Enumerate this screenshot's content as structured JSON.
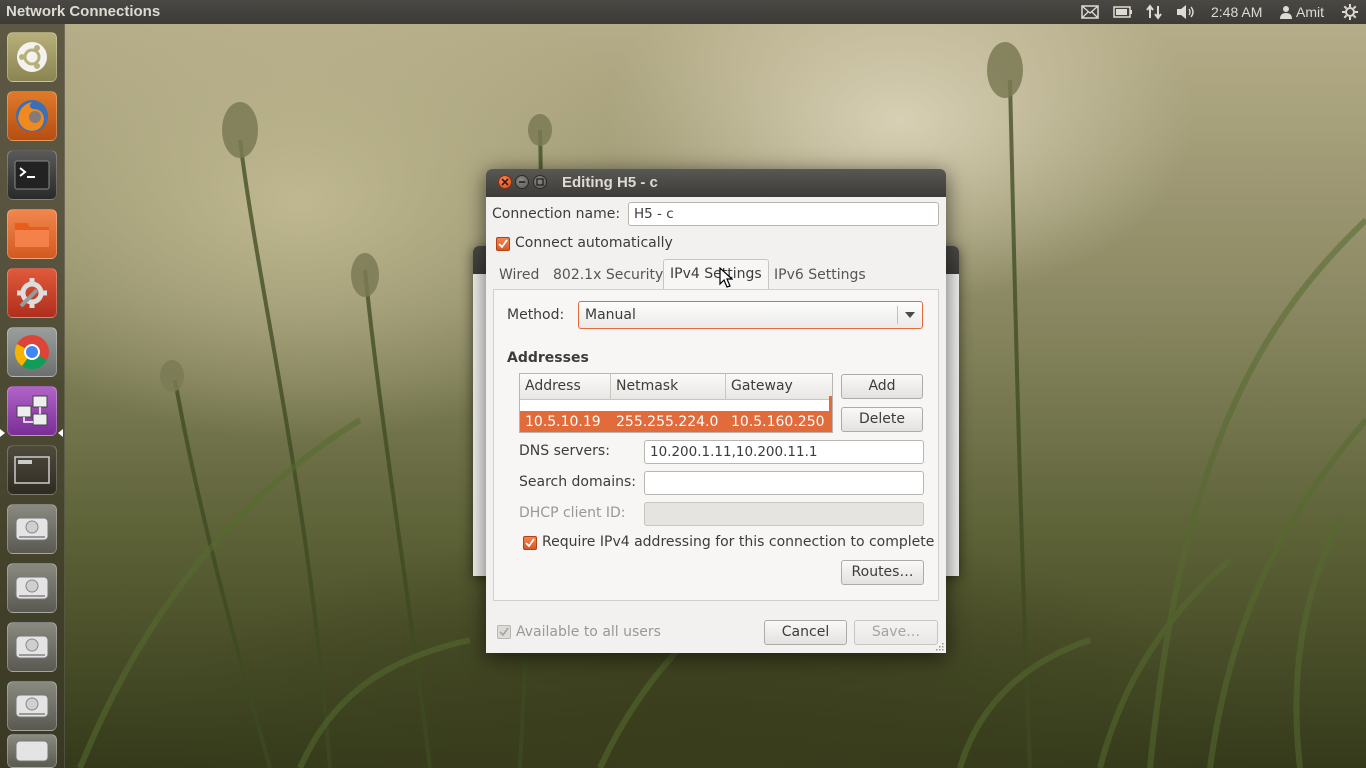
{
  "top_panel": {
    "app_title": "Network Connections",
    "clock": "2:48 AM",
    "user": "Amit",
    "tray_icons": [
      "mail-icon",
      "battery-icon",
      "network-transfer-icon",
      "volume-icon",
      "user-icon",
      "session-gear-icon"
    ]
  },
  "launcher": {
    "items": [
      "dash-home",
      "firefox",
      "terminal",
      "files",
      "system-settings",
      "chrome",
      "network-connections",
      "workspace-switcher",
      "drive",
      "drive",
      "drive",
      "drive",
      "drive"
    ]
  },
  "dialog": {
    "title": "Editing H5 - c",
    "connection_name_label": "Connection name:",
    "connection_name_value": "H5 - c",
    "connect_auto_label": "Connect automatically",
    "connect_auto_checked": true,
    "tabs": [
      {
        "label": "Wired",
        "active": false
      },
      {
        "label": "802.1x Security",
        "active": false
      },
      {
        "label": "IPv4 Settings",
        "active": true
      },
      {
        "label": "IPv6 Settings",
        "active": false
      }
    ],
    "method_label": "Method:",
    "method_value": "Manual",
    "addresses_heading": "Addresses",
    "address_columns": [
      "Address",
      "Netmask",
      "Gateway"
    ],
    "address_rows": [
      {
        "address": "10.5.10.19",
        "netmask": "255.255.224.0",
        "gateway": "10.5.160.250"
      }
    ],
    "add_button": "Add",
    "delete_button": "Delete",
    "dns_label": "DNS servers:",
    "dns_value": "10.200.1.11,10.200.11.1",
    "search_domains_label": "Search domains:",
    "search_domains_value": "",
    "dhcp_client_id_label": "DHCP client ID:",
    "dhcp_client_id_value": "",
    "require_ipv4_label": "Require IPv4 addressing for this connection to complete",
    "require_ipv4_checked": true,
    "routes_button": "Routes…",
    "available_all_users_label": "Available to all users",
    "cancel_button": "Cancel",
    "save_button": "Save…"
  },
  "colors": {
    "accent": "#e26b3b",
    "panel": "#3c3b37",
    "dialog_bg": "#f2f1f0"
  }
}
